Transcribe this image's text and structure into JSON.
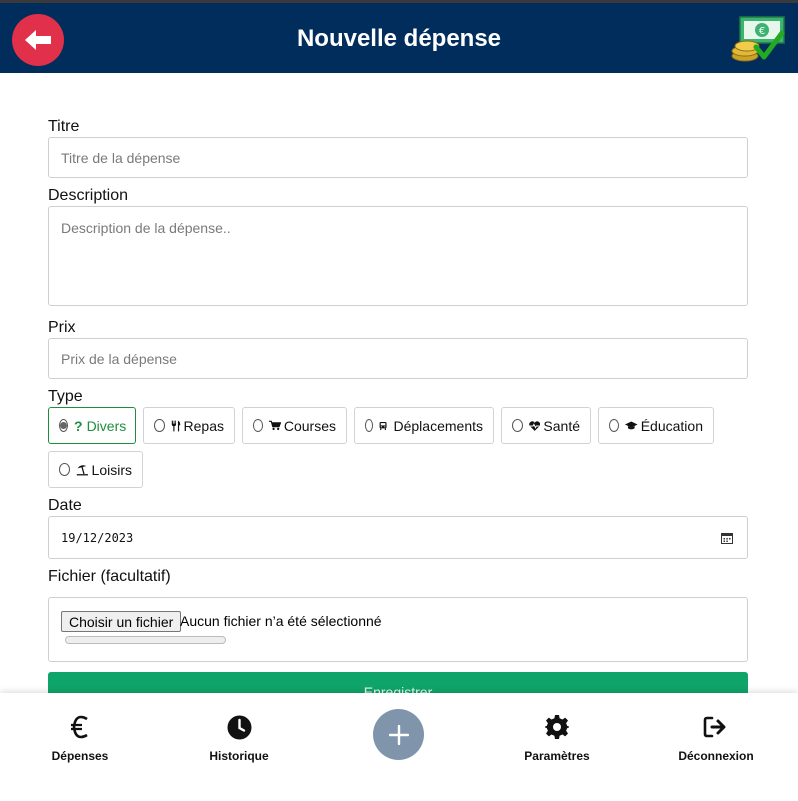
{
  "header": {
    "title": "Nouvelle dépense",
    "back_icon": "arrow-left-icon",
    "logo_icon": "money-check-logo"
  },
  "form": {
    "title_label": "Titre",
    "title_placeholder": "Titre de la dépense",
    "description_label": "Description",
    "description_placeholder": "Description de la dépense..",
    "price_label": "Prix",
    "price_placeholder": "Prix de la dépense",
    "type_label": "Type",
    "types": [
      {
        "label": "Divers",
        "icon": "question-icon",
        "selected": true
      },
      {
        "label": "Repas",
        "icon": "utensils-icon",
        "selected": false
      },
      {
        "label": "Courses",
        "icon": "cart-icon",
        "selected": false
      },
      {
        "label": "Déplacements",
        "icon": "bus-icon",
        "selected": false
      },
      {
        "label": "Santé",
        "icon": "heartbeat-icon",
        "selected": false
      },
      {
        "label": "Éducation",
        "icon": "graduation-cap-icon",
        "selected": false
      },
      {
        "label": "Loisirs",
        "icon": "umbrella-beach-icon",
        "selected": false
      }
    ],
    "date_label": "Date",
    "date_value": "19/12/2023",
    "file_label": "Fichier (facultatif)",
    "file_button": "Choisir un fichier",
    "file_status": "Aucun fichier n’a été sélectionné",
    "upload_progress": 0,
    "save_label": "Enregistrer"
  },
  "nav": {
    "items": [
      {
        "label": "Dépenses",
        "icon": "euro-icon"
      },
      {
        "label": "Historique",
        "icon": "clock-icon"
      },
      {
        "label": "",
        "icon": "plus-icon"
      },
      {
        "label": "Paramètres",
        "icon": "gear-icon"
      },
      {
        "label": "Déconnexion",
        "icon": "logout-icon"
      }
    ]
  },
  "colors": {
    "header": "#002d5c",
    "back": "#e0304a",
    "accent": "#0fa56a",
    "selected": "#1e8e3e",
    "plus": "#8094ab"
  }
}
